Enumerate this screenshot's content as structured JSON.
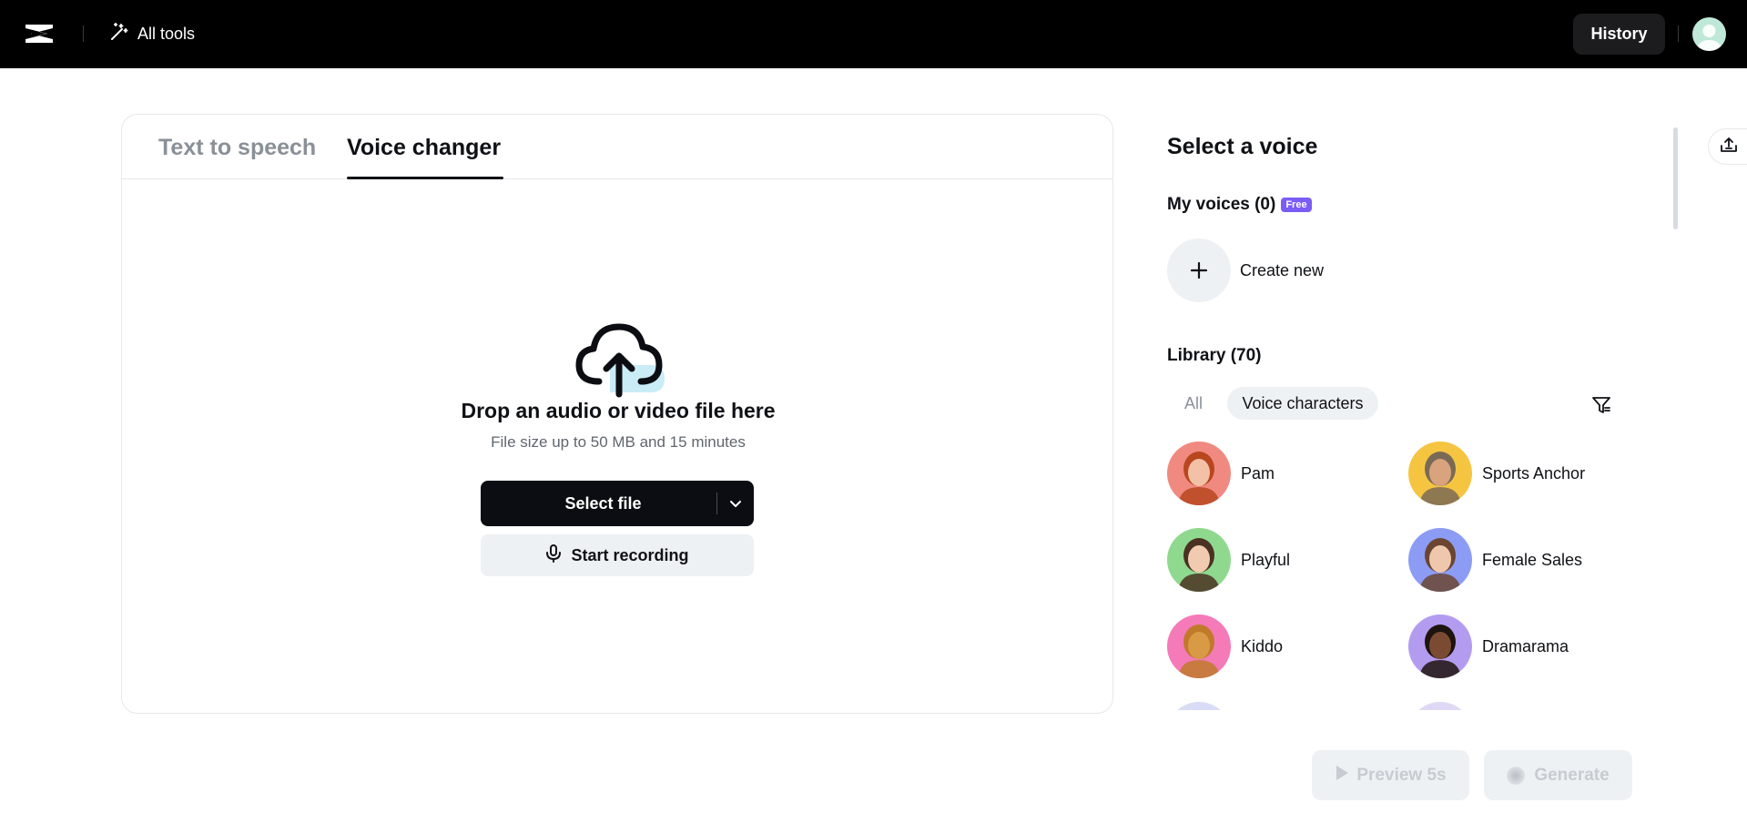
{
  "topbar": {
    "all_tools_label": "All tools",
    "history_label": "History"
  },
  "tabs": [
    {
      "label": "Text to speech",
      "active": false
    },
    {
      "label": "Voice changer",
      "active": true
    }
  ],
  "upload": {
    "title": "Drop an audio or video file here",
    "subtitle": "File size up to 50 MB and 15 minutes",
    "select_file_label": "Select file",
    "start_recording_label": "Start recording"
  },
  "voice_panel": {
    "title": "Select a voice",
    "my_voices_label": "My voices (0)",
    "free_badge": "Free",
    "create_new_label": "Create new",
    "library_label": "Library (70)",
    "filters": [
      {
        "label": "All",
        "active": false
      },
      {
        "label": "Voice characters",
        "active": true
      }
    ],
    "voices": [
      {
        "name": "Pam",
        "bg": "#f08a80",
        "skin": "#f3c2a6",
        "hair": "#b8461f"
      },
      {
        "name": "Sports Anchor",
        "bg": "#f5c542",
        "skin": "#d9a37e",
        "hair": "#7a6a55"
      },
      {
        "name": "Playful",
        "bg": "#8fd98f",
        "skin": "#f1cbb0",
        "hair": "#4a3122"
      },
      {
        "name": "Female Sales",
        "bg": "#8c9cf5",
        "skin": "#efc7ad",
        "hair": "#6b4530"
      },
      {
        "name": "Kiddo",
        "bg": "#f57ab8",
        "skin": "#d99a45",
        "hair": "#c07a2a"
      },
      {
        "name": "Dramarama",
        "bg": "#b39cf0",
        "skin": "#7a4b32",
        "hair": "#1e130e"
      }
    ]
  },
  "actions": {
    "preview_label": "Preview 5s",
    "generate_label": "Generate"
  },
  "colors": {
    "topbar_bg": "#000000",
    "primary_button": "#0c0d12",
    "free_badge": "#7b5cf5",
    "chip_bg": "#eef1f4"
  }
}
